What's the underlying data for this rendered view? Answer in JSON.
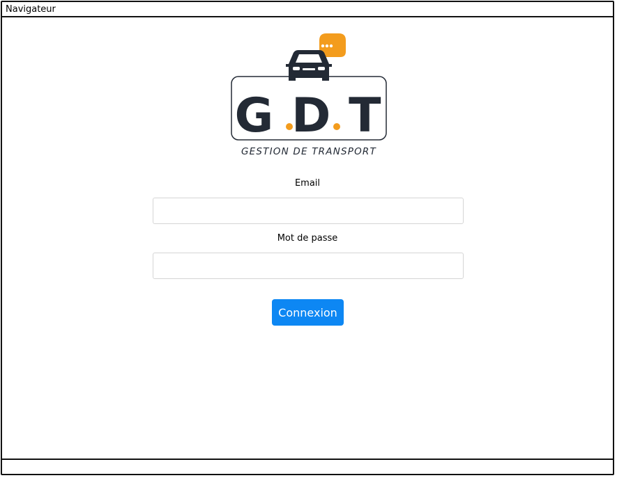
{
  "window": {
    "title": "Navigateur"
  },
  "logo": {
    "brand": "G.D.T",
    "tagline": "GESTION DE TRANSPORT",
    "colors": {
      "dark": "#232a35",
      "accent": "#f39c1d"
    },
    "icons": [
      "car-icon",
      "chat-bubble-icon"
    ]
  },
  "login": {
    "email_label": "Email",
    "email_value": "",
    "password_label": "Mot de passe",
    "password_value": "",
    "submit_label": "Connexion"
  },
  "colors": {
    "button": "#0d87f3",
    "button_text": "#ffffff",
    "border": "#111111"
  }
}
